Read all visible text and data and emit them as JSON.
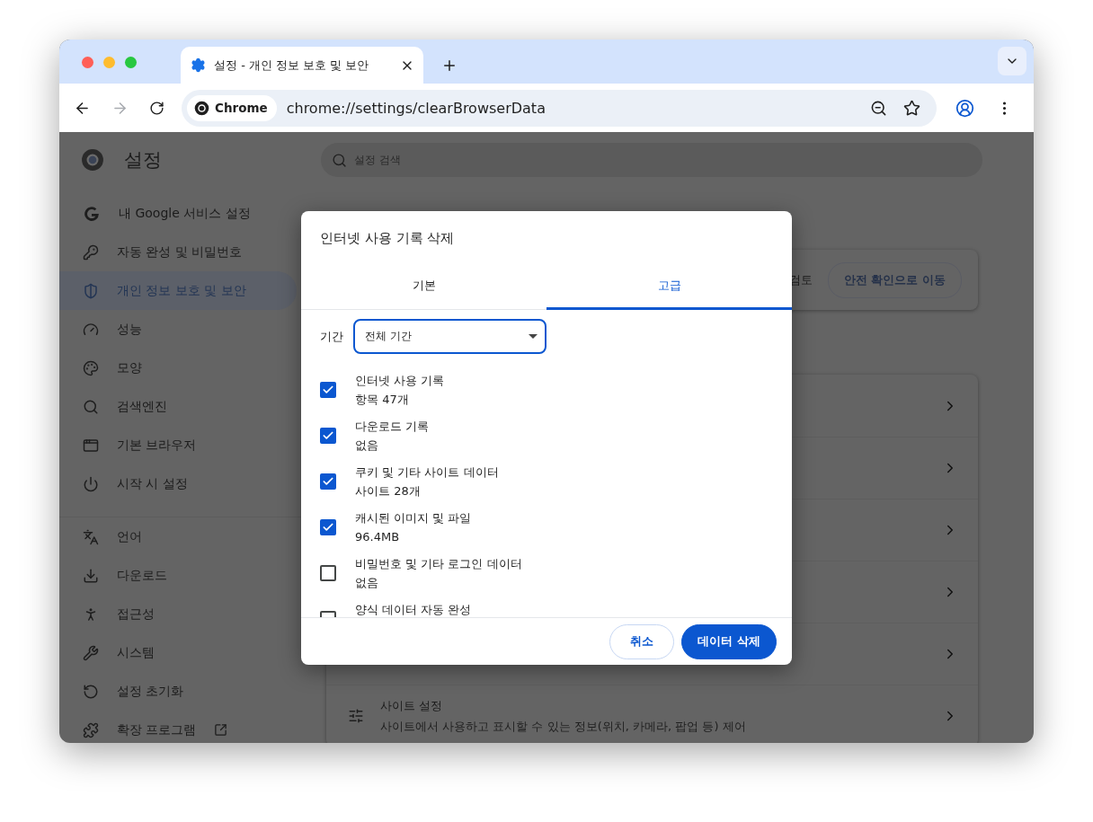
{
  "tab": {
    "title": "설정 - 개인 정보 보호 및 보안"
  },
  "toolbar": {
    "forward_disabled": true,
    "chip": "Chrome",
    "url": "chrome://settings/clearBrowserData"
  },
  "settings": {
    "title": "설정",
    "search_placeholder": "설정 검색",
    "sidebar": [
      [
        {
          "label": "내 Google 서비스 설정",
          "selected": false
        },
        {
          "label": "자동 완성 및 비밀번호",
          "selected": false
        },
        {
          "label": "개인 정보 보호 및 보안",
          "selected": true
        },
        {
          "label": "성능",
          "selected": false
        },
        {
          "label": "모양",
          "selected": false
        },
        {
          "label": "검색엔진",
          "selected": false
        },
        {
          "label": "기본 브라우저",
          "selected": false
        },
        {
          "label": "시작 시 설정",
          "selected": false
        }
      ],
      [
        {
          "label": "언어",
          "selected": false
        },
        {
          "label": "다운로드",
          "selected": false
        },
        {
          "label": "접근성",
          "selected": false
        },
        {
          "label": "시스템",
          "selected": false
        },
        {
          "label": "설정 초기화",
          "selected": false
        },
        {
          "label": "확장 프로그램",
          "selected": false
        }
      ]
    ],
    "safety_card": {
      "text": "검토",
      "button": "안전 확인으로 이동"
    },
    "site_settings": {
      "title": "사이트 설정",
      "description": "사이트에서 사용하고 표시할 수 있는 정보(위치, 카메라, 팝업 등) 제어"
    }
  },
  "dialog": {
    "title": "인터넷 사용 기록 삭제",
    "tabs": [
      {
        "label": "기본",
        "selected": false
      },
      {
        "label": "고급",
        "selected": true
      }
    ],
    "period_label": "기간",
    "period_value": "전체 기간",
    "items": [
      {
        "title": "인터넷 사용 기록",
        "detail": "항목 47개",
        "checked": true
      },
      {
        "title": "다운로드 기록",
        "detail": "없음",
        "checked": true
      },
      {
        "title": "쿠키 및 기타 사이트 데이터",
        "detail": "사이트 28개",
        "checked": true
      },
      {
        "title": "캐시된 이미지 및 파일",
        "detail": "96.4MB",
        "checked": true
      },
      {
        "title": "비밀번호 및 기타 로그인 데이터",
        "detail": "없음",
        "checked": false
      },
      {
        "title": "양식 데이터 자동 완성",
        "checked": false
      }
    ],
    "cancel": "취소",
    "confirm": "데이터 삭제"
  }
}
